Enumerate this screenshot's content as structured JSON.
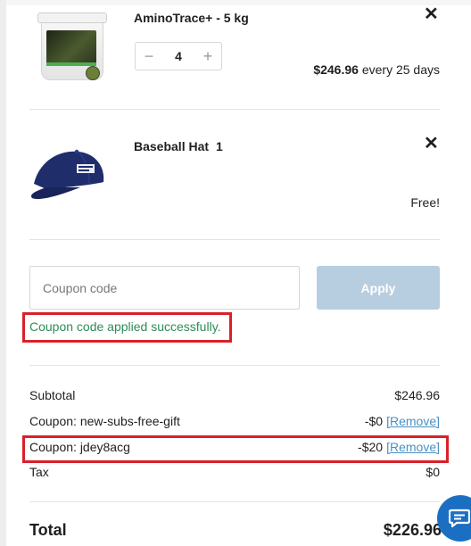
{
  "cart": {
    "items": [
      {
        "title": "AminoTrace+ - 5 kg",
        "quantity": "4",
        "minus_symbol": "−",
        "plus_symbol": "+",
        "price": "$246.96",
        "frequency": "every 25 days",
        "remove_symbol": "✕",
        "image_icon": "supplement-bucket-image"
      },
      {
        "title": "Baseball Hat",
        "quantity": "1",
        "price": "Free!",
        "remove_symbol": "✕",
        "image_icon": "baseball-hat-image"
      }
    ]
  },
  "coupon": {
    "placeholder": "Coupon code",
    "apply_label": "Apply",
    "success_message": "Coupon code applied successfully."
  },
  "summary": {
    "subtotal_label": "Subtotal",
    "subtotal_value": "$246.96",
    "coupons": [
      {
        "label": "Coupon: new-subs-free-gift",
        "value": "-$0",
        "remove_label": "[Remove]"
      },
      {
        "label": "Coupon: jdey8acg",
        "value": "-$20",
        "remove_label": "[Remove]"
      }
    ],
    "tax_label": "Tax",
    "tax_value": "$0",
    "total_label": "Total",
    "total_value": "$226.96"
  },
  "colors": {
    "success": "#2e8b57",
    "highlight": "#d9202a",
    "link": "#4a90c4",
    "apply_button": "#b7cde0",
    "chat_button": "#1b6fc2"
  }
}
